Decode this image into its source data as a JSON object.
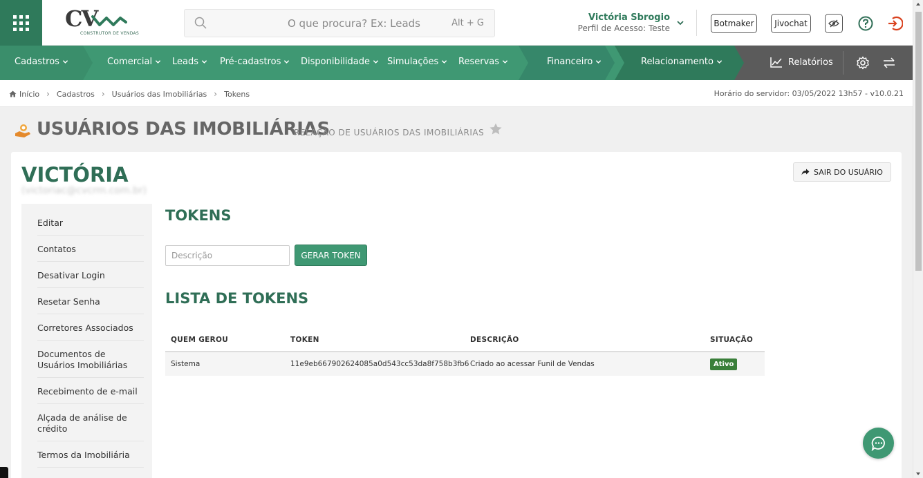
{
  "header": {
    "logo_text": "CV",
    "logo_subtitle": "CONSTRUTOR DE VENDAS",
    "search_placeholder": "O que procura? Ex: Leads",
    "search_shortcut": "Alt + G",
    "user_name": "Victória Sbrogio",
    "user_role": "Perfil de Acesso: Teste",
    "botmaker_label": "Botmaker",
    "jivochat_label": "Jivochat"
  },
  "nav": {
    "items": [
      {
        "label": "Cadastros"
      },
      {
        "label": "Comercial"
      },
      {
        "label": "Leads"
      },
      {
        "label": "Pré-cadastros"
      },
      {
        "label": "Disponibilidade"
      },
      {
        "label": "Simulações"
      },
      {
        "label": "Reservas"
      },
      {
        "label": "Financeiro"
      },
      {
        "label": "Relacionamento"
      }
    ],
    "reports_label": "Relatórios"
  },
  "breadcrumb": {
    "items": [
      "Início",
      "Cadastros",
      "Usuários das Imobiliárias",
      "Tokens"
    ],
    "server_time": "Horário do servidor: 03/05/2022 13h57 - v10.0.21"
  },
  "page": {
    "title": "USUÁRIOS DAS IMOBILIÁRIAS",
    "subtitle": "RELAÇÃO DE USUÁRIOS DAS IMOBILIÁRIAS"
  },
  "user": {
    "name": "VICTÓRIA",
    "email": "(victoriac@cvcrm.com.br)",
    "exit_label": "SAIR DO USUÁRIO"
  },
  "sidemenu": {
    "items": [
      "Editar",
      "Contatos",
      "Desativar Login",
      "Resetar Senha",
      "Corretores Associados",
      "Documentos de Usuários Imobiliárias",
      "Recebimento de e-mail",
      "Alçada de análise de crédito",
      "Termos da Imobiliária"
    ]
  },
  "tokens": {
    "title": "TOKENS",
    "description_placeholder": "Descrição",
    "generate_label": "GERAR TOKEN",
    "list_title": "LISTA DE TOKENS",
    "columns": [
      "QUEM GEROU",
      "TOKEN",
      "DESCRIÇÃO",
      "SITUAÇÃO"
    ],
    "rows": [
      {
        "generated_by": "Sistema",
        "token": "11e9eb667902624085a0d543cc53da8f758b3fb6",
        "description": "Criado ao acessar Funil de Vendas",
        "status": "Ativo"
      }
    ]
  },
  "colors": {
    "primary_green": "#3f9873",
    "dark_green": "#2f7a5b",
    "heading_green": "#2f6e56",
    "status_active": "#3a7f3a",
    "logout_red": "#d9411e"
  }
}
